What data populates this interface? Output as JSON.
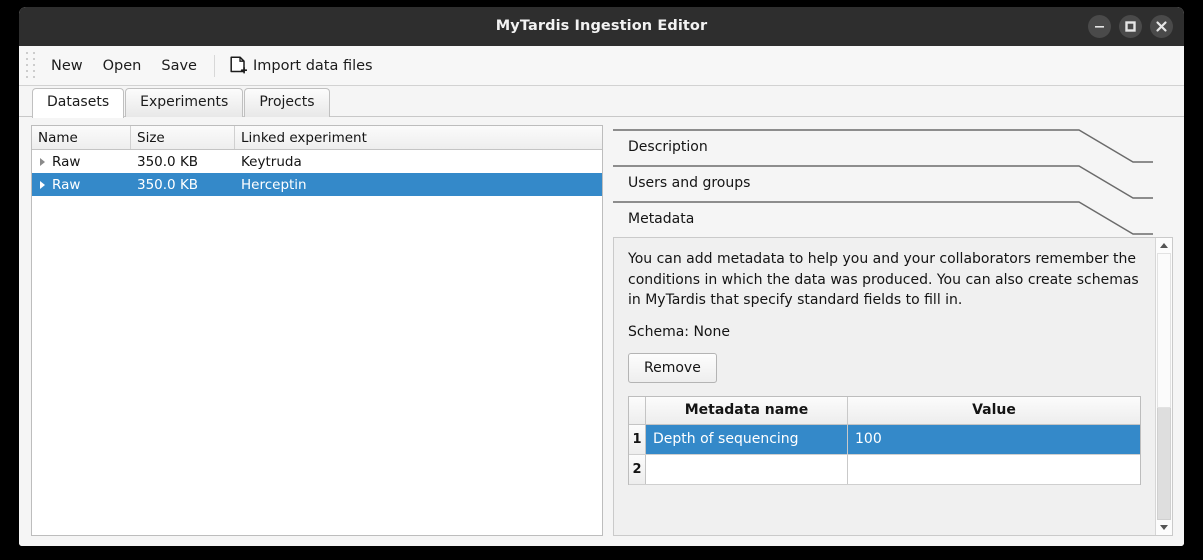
{
  "window": {
    "title": "MyTardis Ingestion Editor",
    "controls": [
      {
        "name": "minimize",
        "glyph": "minimize-icon"
      },
      {
        "name": "maximize",
        "glyph": "maximize-icon"
      },
      {
        "name": "close",
        "glyph": "close-icon"
      }
    ]
  },
  "toolbar": {
    "new_label": "New",
    "open_label": "Open",
    "save_label": "Save",
    "import_label": "Import data files",
    "import_icon": "file-add-icon"
  },
  "tabs": [
    {
      "label": "Datasets",
      "active": true
    },
    {
      "label": "Experiments",
      "active": false
    },
    {
      "label": "Projects",
      "active": false
    }
  ],
  "dataset_table": {
    "columns": [
      "Name",
      "Size",
      "Linked experiment"
    ],
    "rows": [
      {
        "name": "Raw",
        "size": "350.0 KB",
        "experiment": "Keytruda",
        "selected": false
      },
      {
        "name": "Raw",
        "size": "350.0 KB",
        "experiment": "Herceptin",
        "selected": true
      }
    ]
  },
  "accordion": {
    "sections": [
      {
        "label": "Description",
        "expanded": false
      },
      {
        "label": "Users and groups",
        "expanded": false
      },
      {
        "label": "Metadata",
        "expanded": true
      }
    ]
  },
  "metadata_panel": {
    "description": "You can add metadata to help you and your collaborators remember the conditions in which the data was produced. You can also create schemas in MyTardis that specify standard fields to fill in.",
    "schema_label": "Schema: None",
    "remove_button": "Remove",
    "table": {
      "columns": [
        "Metadata name",
        "Value"
      ],
      "rows": [
        {
          "index": "1",
          "name": "Depth of sequencing",
          "value": "100",
          "selected": true
        },
        {
          "index": "2",
          "name": "",
          "value": "",
          "selected": false
        }
      ]
    }
  },
  "colors": {
    "selection_blue": "#3489c9",
    "titlebar": "#2e2e2e",
    "window_bg": "#f5f5f5",
    "panel_bg": "#f0f0f0"
  }
}
